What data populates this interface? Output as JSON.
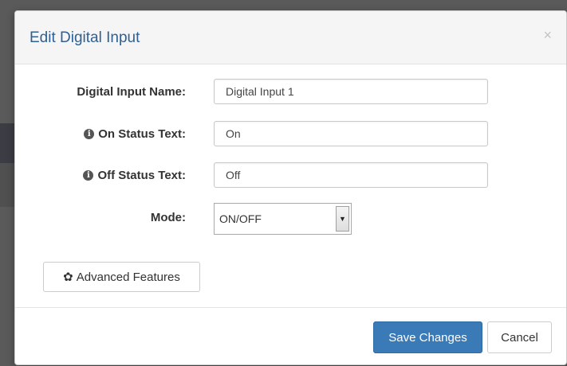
{
  "dialog": {
    "title": "Edit Digital Input",
    "close_glyph": "×"
  },
  "form": {
    "name_label": "Digital Input Name:",
    "name_value": "Digital Input 1",
    "on_label": "On Status Text:",
    "on_value": "On",
    "off_label": "Off Status Text:",
    "off_value": "Off",
    "mode_label": "Mode:",
    "mode_value": "ON/OFF",
    "info_icon": "info-circle-icon"
  },
  "advanced": {
    "label": "Advanced Features",
    "icon": "gear-icon"
  },
  "footer": {
    "save_label": "Save Changes",
    "cancel_label": "Cancel"
  },
  "colors": {
    "title": "#2f5f93",
    "primary_button": "#3a7ab7"
  }
}
